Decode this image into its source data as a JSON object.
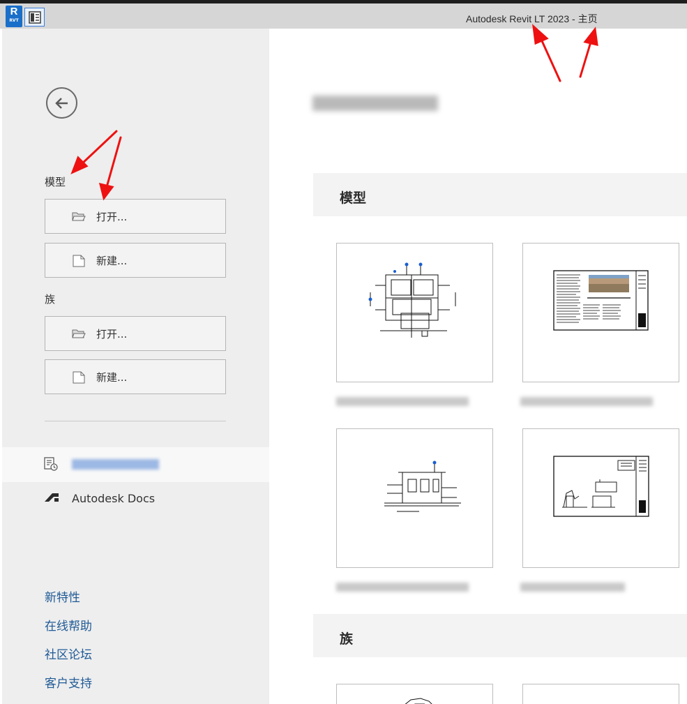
{
  "titlebar": {
    "app_badge": "R",
    "app_badge_sub": "RVT",
    "window_title": "Autodesk Revit LT 2023 - 主页"
  },
  "left_pane": {
    "model_section": {
      "label": "模型",
      "open_label": "打开...",
      "new_label": "新建..."
    },
    "family_section": {
      "label": "族",
      "open_label": "打开...",
      "new_label": "新建..."
    },
    "nav": {
      "docs_label": "Autodesk Docs"
    },
    "links": {
      "whats_new": "新特性",
      "online_help": "在线帮助",
      "community": "社区论坛",
      "support": "客户支持"
    }
  },
  "main_pane": {
    "model_band_label": "模型",
    "family_band_label": "族"
  },
  "colors": {
    "accent": "#1a6fc9",
    "link": "#1f5a96",
    "title_bar": "#d6d6d6",
    "left_pane": "#eeeeee"
  }
}
